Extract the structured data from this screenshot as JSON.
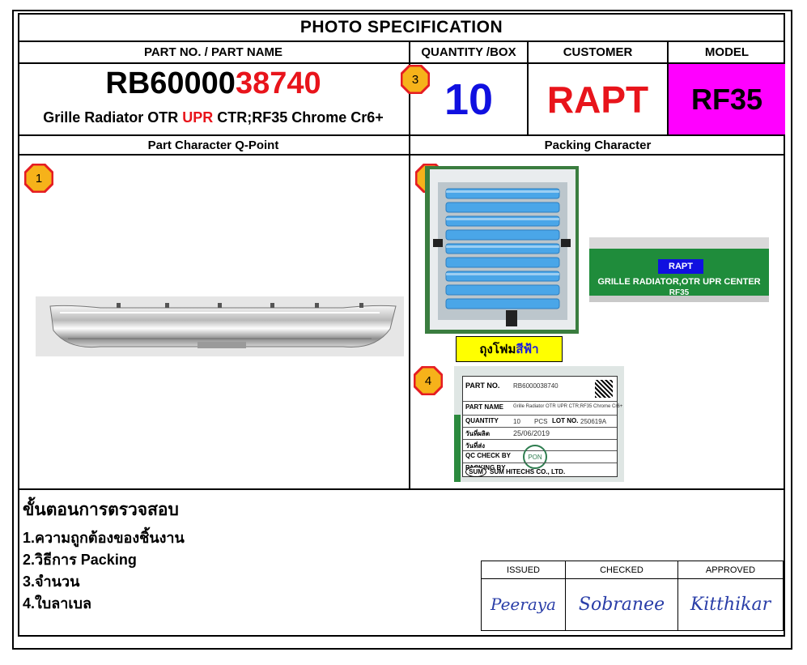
{
  "title": "PHOTO  SPECIFICATION",
  "headers": {
    "part": "PART NO. / PART NAME",
    "quantity": "QUANTITY /BOX",
    "customer": "CUSTOMER",
    "model": "MODEL",
    "q_point": "Part Character Q-Point",
    "packing": "Packing Character"
  },
  "part": {
    "number_prefix": "RB60000",
    "number_suffix": "38740",
    "name_a": "Grille Radiator OTR ",
    "name_red": "UPR",
    "name_b": " CTR;RF35 Chrome Cr6+"
  },
  "quantity": "10",
  "customer": "RAPT",
  "model": "RF35",
  "markers": [
    "1",
    "2",
    "3",
    "4"
  ],
  "photos": {
    "sign_customer": "RAPT",
    "sign_line1": "GRILLE RADIATOR,OTR UPR CENTER",
    "sign_line2": "RF35",
    "foam_label_a": "ถุงโฟม",
    "foam_label_b": "สีฟ้า"
  },
  "label_card": {
    "part_no_key": "PART NO.",
    "part_no_val": "RB6000038740",
    "part_name_key": "PART NAME",
    "part_name_val": "Grille Radiator OTR UPR CTR;RF35 Chrome Cr6+",
    "quantity_key": "QUANTITY",
    "quantity_val": "10",
    "pcs": "PCS",
    "lot_key": "LOT NO.",
    "lot_val": "250619A",
    "date_key": "วันที่ผลิต",
    "date_val": "25/06/2019",
    "send_key": "วันที่ส่ง",
    "qc_key": "QC CHECK BY",
    "pack_key": "PACKING BY",
    "stamp": "PON",
    "company_logo": "SUM",
    "company": "SUM HITECHS CO., LTD."
  },
  "procedure": {
    "title": "ขั้นตอนการตรวจสอบ",
    "items": [
      "1.ความถูกต้องของชิ้นงาน",
      "2.วิธีการ Packing",
      "3.จำนวน",
      "4.ใบลาเบล"
    ]
  },
  "signoff": {
    "issued_label": "ISSUED",
    "checked_label": "CHECKED",
    "approved_label": "APPROVED",
    "issued_sig": "Peeraya",
    "checked_sig": "Sobranee",
    "approved_sig": "Kitthikar"
  },
  "colors": {
    "red": "#e8141b",
    "blue": "#1010e0",
    "magenta": "#ff00ff",
    "yellow": "#ffff00",
    "marker_fill": "#f6b21a",
    "marker_border": "#e51c23"
  }
}
